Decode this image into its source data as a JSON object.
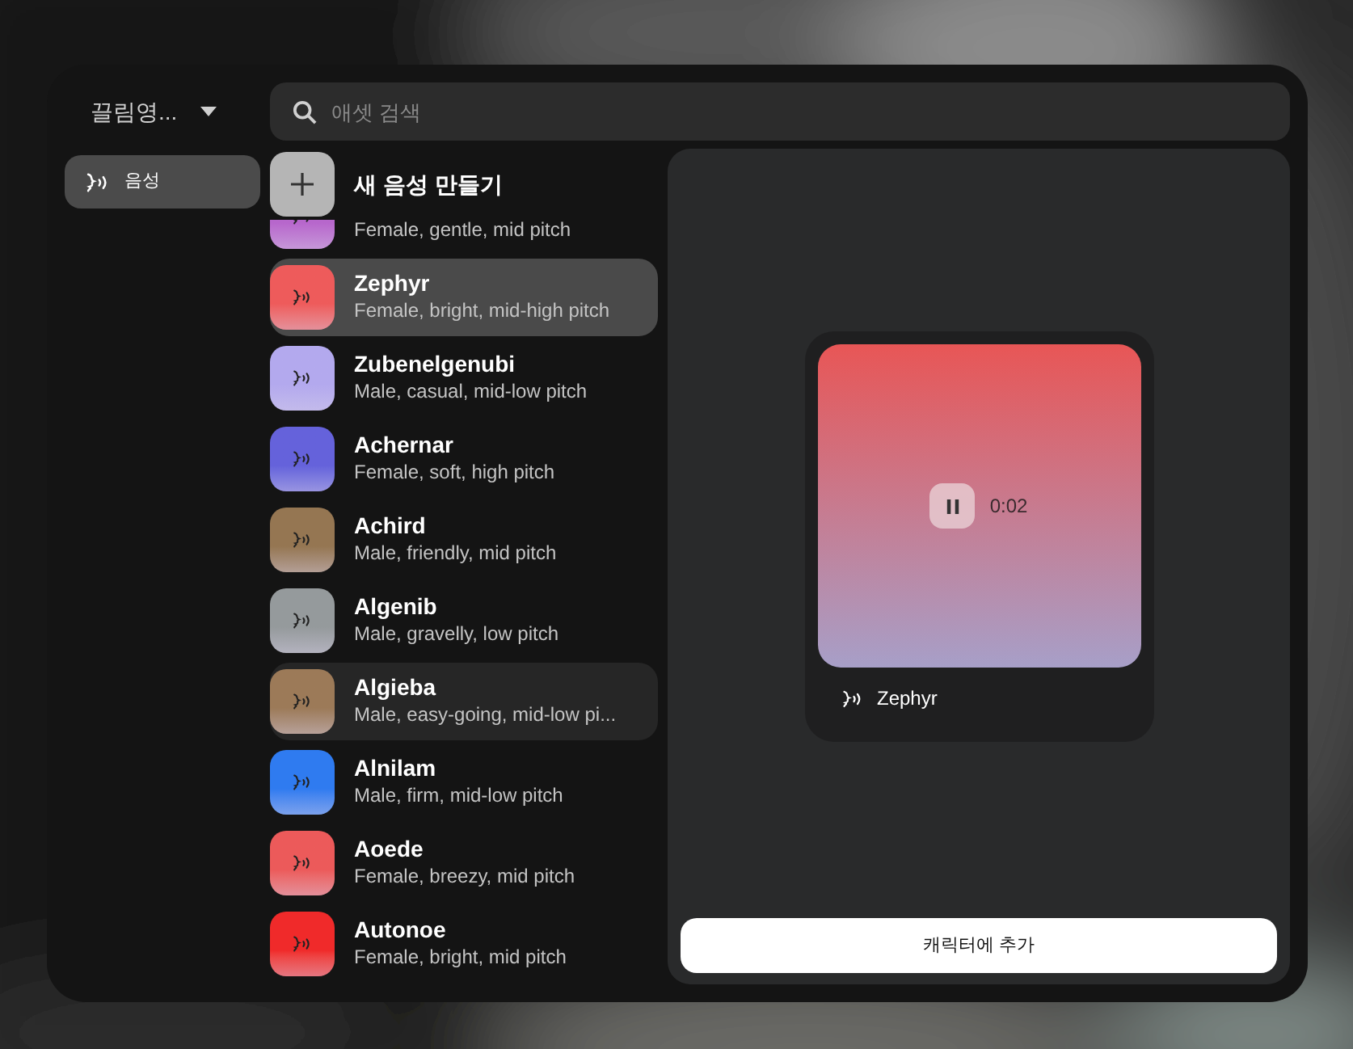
{
  "workspace": {
    "label": "끌림영...",
    "expanded": false
  },
  "sidebar": {
    "items": [
      {
        "label": "음성",
        "selected": true
      }
    ]
  },
  "search": {
    "placeholder": "애셋 검색"
  },
  "create_button": {
    "label": "새 음성 만들기"
  },
  "voices": [
    {
      "description": "Female, gentle, mid pitch",
      "color": "#b767cc",
      "selected": false,
      "hovered": false
    },
    {
      "name": "Zephyr",
      "description": "Female, bright, mid-high pitch",
      "color": "#ee5b5b",
      "selected": true,
      "hovered": false
    },
    {
      "name": "Zubenelgenubi",
      "description": "Male, casual, mid-low pitch",
      "color": "#b3a9ee",
      "selected": false,
      "hovered": false
    },
    {
      "name": "Achernar",
      "description": "Female, soft, high pitch",
      "color": "#6562db",
      "selected": false,
      "hovered": false
    },
    {
      "name": "Achird",
      "description": "Male, friendly, mid pitch",
      "color": "#957652",
      "selected": false,
      "hovered": false
    },
    {
      "name": "Algenib",
      "description": "Male, gravelly, low pitch",
      "color": "#959a9c",
      "selected": false,
      "hovered": false
    },
    {
      "name": "Algieba",
      "description": "Male, easy-going, mid-low pi...",
      "color": "#9c7a58",
      "selected": false,
      "hovered": true
    },
    {
      "name": "Alnilam",
      "description": "Male, firm, mid-low pitch",
      "color": "#2f7bf0",
      "selected": false,
      "hovered": false
    },
    {
      "name": "Aoede",
      "description": "Female, breezy, mid pitch",
      "color": "#ec5a5a",
      "selected": false,
      "hovered": false
    },
    {
      "name": "Autonoe",
      "description": "Female, bright, mid pitch",
      "color": "#f02a2a",
      "selected": false,
      "hovered": false
    }
  ],
  "preview": {
    "name": "Zephyr",
    "time": "0:02",
    "playing": true,
    "color": "#e85656"
  },
  "add_button": {
    "label": "캐릭터에 추가"
  }
}
